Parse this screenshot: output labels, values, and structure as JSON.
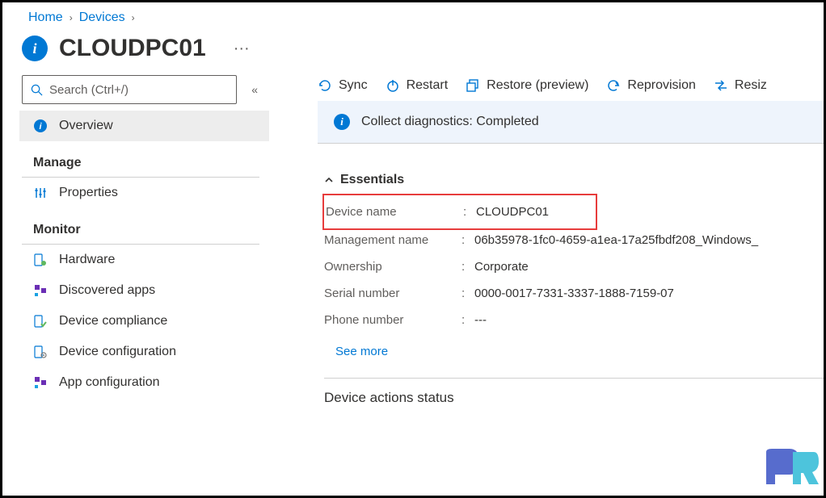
{
  "breadcrumb": {
    "home": "Home",
    "devices": "Devices"
  },
  "header": {
    "title": "CLOUDPC01"
  },
  "search": {
    "placeholder": "Search (Ctrl+/)"
  },
  "sidebar": {
    "overview": "Overview",
    "manage_header": "Manage",
    "properties": "Properties",
    "monitor_header": "Monitor",
    "hardware": "Hardware",
    "discovered_apps": "Discovered apps",
    "device_compliance": "Device compliance",
    "device_configuration": "Device configuration",
    "app_configuration": "App configuration"
  },
  "commands": {
    "sync": "Sync",
    "restart": "Restart",
    "restore": "Restore (preview)",
    "reprovision": "Reprovision",
    "resize": "Resiz"
  },
  "infobar": {
    "text": "Collect diagnostics: Completed"
  },
  "essentials": {
    "title": "Essentials",
    "rows": [
      {
        "label": "Device name",
        "value": "CLOUDPC01"
      },
      {
        "label": "Management name",
        "value": "06b35978-1fc0-4659-a1ea-17a25fbdf208_Windows_"
      },
      {
        "label": "Ownership",
        "value": "Corporate"
      },
      {
        "label": "Serial number",
        "value": "0000-0017-7331-3337-1888-7159-07"
      },
      {
        "label": "Phone number",
        "value": "---"
      }
    ],
    "see_more": "See more"
  },
  "sections": {
    "device_actions": "Device actions status"
  }
}
